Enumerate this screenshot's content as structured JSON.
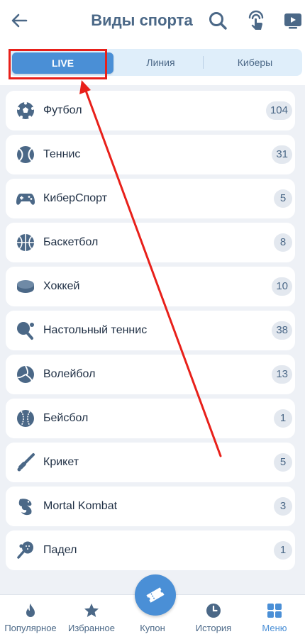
{
  "header": {
    "title": "Виды спорта",
    "icons": [
      "back-arrow-icon",
      "search-icon",
      "touch-finger-icon",
      "tv-broadcast-icon"
    ]
  },
  "tabs": [
    {
      "label": "LIVE",
      "active": true
    },
    {
      "label": "Линия",
      "active": false
    },
    {
      "label": "Киберы",
      "active": false
    }
  ],
  "sports": [
    {
      "label": "Футбол",
      "count": "104",
      "icon": "football-icon"
    },
    {
      "label": "Теннис",
      "count": "31",
      "icon": "tennis-icon"
    },
    {
      "label": "КиберСпорт",
      "count": "5",
      "icon": "gamepad-icon"
    },
    {
      "label": "Баскетбол",
      "count": "8",
      "icon": "basketball-icon"
    },
    {
      "label": "Хоккей",
      "count": "10",
      "icon": "hockey-puck-icon"
    },
    {
      "label": "Настольный теннис",
      "count": "38",
      "icon": "table-tennis-icon"
    },
    {
      "label": "Волейбол",
      "count": "13",
      "icon": "volleyball-icon"
    },
    {
      "label": "Бейсбол",
      "count": "1",
      "icon": "baseball-icon"
    },
    {
      "label": "Крикет",
      "count": "5",
      "icon": "cricket-icon"
    },
    {
      "label": "Mortal Kombat",
      "count": "3",
      "icon": "dragon-icon"
    },
    {
      "label": "Падел",
      "count": "1",
      "icon": "padel-icon"
    }
  ],
  "bottom_nav": [
    {
      "label": "Популярное",
      "icon": "flame-icon"
    },
    {
      "label": "Избранное",
      "icon": "star-icon"
    },
    {
      "label": "Купон",
      "icon": "ticket-icon"
    },
    {
      "label": "История",
      "icon": "clock-icon"
    },
    {
      "label": "Меню",
      "icon": "grid-icon"
    }
  ],
  "colors": {
    "accent": "#4a8fd6",
    "annotation": "#e8201a",
    "icon": "#4b6887"
  }
}
